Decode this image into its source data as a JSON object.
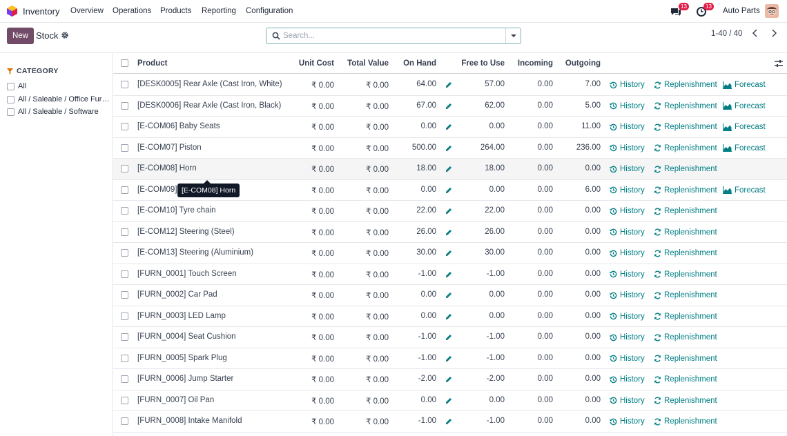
{
  "app": {
    "name": "Inventory",
    "logo_icon": "inventory-logo-icon"
  },
  "menu": [
    {
      "label": "Overview"
    },
    {
      "label": "Operations"
    },
    {
      "label": "Products"
    },
    {
      "label": "Reporting"
    },
    {
      "label": "Configuration"
    }
  ],
  "systray": {
    "messages_count": "13",
    "activities_count": "13",
    "company": "Auto Parts"
  },
  "control": {
    "new_label": "New",
    "title": "Stock",
    "search_placeholder": "Search...",
    "pager": "1-40 / 40"
  },
  "sidebar": {
    "title": "CATEGORY",
    "items": [
      {
        "label": "All"
      },
      {
        "label": "All / Saleable / Office Furn..."
      },
      {
        "label": "All / Saleable / Software"
      }
    ]
  },
  "table": {
    "headers": {
      "product": "Product",
      "unit_cost": "Unit Cost",
      "total_value": "Total Value",
      "on_hand": "On Hand",
      "free_to_use": "Free to Use",
      "incoming": "Incoming",
      "outgoing": "Outgoing"
    },
    "action_labels": {
      "history": "History",
      "replenishment": "Replenishment",
      "forecast": "Forecast"
    },
    "rows": [
      {
        "product": "[DESK0005] Rear Axle (Cast Iron, White)",
        "unit_cost": "₹ 0.00",
        "total_value": "₹ 0.00",
        "on_hand": "64.00",
        "free": "57.00",
        "incoming": "0.00",
        "outgoing": "7.00",
        "forecast": true
      },
      {
        "product": "[DESK0006] Rear Axle (Cast Iron, Black)",
        "unit_cost": "₹ 0.00",
        "total_value": "₹ 0.00",
        "on_hand": "67.00",
        "free": "62.00",
        "incoming": "0.00",
        "outgoing": "5.00",
        "forecast": true
      },
      {
        "product": "[E-COM06] Baby Seats",
        "unit_cost": "₹ 0.00",
        "total_value": "₹ 0.00",
        "on_hand": "0.00",
        "free": "0.00",
        "incoming": "0.00",
        "outgoing": "11.00",
        "forecast": true
      },
      {
        "product": "[E-COM07] Piston",
        "unit_cost": "₹ 0.00",
        "total_value": "₹ 0.00",
        "on_hand": "500.00",
        "free": "264.00",
        "incoming": "0.00",
        "outgoing": "236.00",
        "forecast": true
      },
      {
        "product": "[E-COM08] Horn",
        "unit_cost": "₹ 0.00",
        "total_value": "₹ 0.00",
        "on_hand": "18.00",
        "free": "18.00",
        "incoming": "0.00",
        "outgoing": "0.00",
        "forecast": false
      },
      {
        "product": "[E-COM09]",
        "unit_cost": "₹ 0.00",
        "total_value": "₹ 0.00",
        "on_hand": "0.00",
        "free": "0.00",
        "incoming": "0.00",
        "outgoing": "6.00",
        "forecast": true
      },
      {
        "product": "[E-COM10] Tyre chain",
        "unit_cost": "₹ 0.00",
        "total_value": "₹ 0.00",
        "on_hand": "22.00",
        "free": "22.00",
        "incoming": "0.00",
        "outgoing": "0.00",
        "forecast": false
      },
      {
        "product": "[E-COM12] Steering (Steel)",
        "unit_cost": "₹ 0.00",
        "total_value": "₹ 0.00",
        "on_hand": "26.00",
        "free": "26.00",
        "incoming": "0.00",
        "outgoing": "0.00",
        "forecast": false
      },
      {
        "product": "[E-COM13] Steering (Aluminium)",
        "unit_cost": "₹ 0.00",
        "total_value": "₹ 0.00",
        "on_hand": "30.00",
        "free": "30.00",
        "incoming": "0.00",
        "outgoing": "0.00",
        "forecast": false
      },
      {
        "product": "[FURN_0001] Touch Screen",
        "unit_cost": "₹ 0.00",
        "total_value": "₹ 0.00",
        "on_hand": "-1.00",
        "free": "-1.00",
        "incoming": "0.00",
        "outgoing": "0.00",
        "forecast": false
      },
      {
        "product": "[FURN_0002] Car Pad",
        "unit_cost": "₹ 0.00",
        "total_value": "₹ 0.00",
        "on_hand": "0.00",
        "free": "0.00",
        "incoming": "0.00",
        "outgoing": "0.00",
        "forecast": false
      },
      {
        "product": "[FURN_0003] LED Lamp",
        "unit_cost": "₹ 0.00",
        "total_value": "₹ 0.00",
        "on_hand": "0.00",
        "free": "0.00",
        "incoming": "0.00",
        "outgoing": "0.00",
        "forecast": false
      },
      {
        "product": "[FURN_0004] Seat Cushion",
        "unit_cost": "₹ 0.00",
        "total_value": "₹ 0.00",
        "on_hand": "-1.00",
        "free": "-1.00",
        "incoming": "0.00",
        "outgoing": "0.00",
        "forecast": false
      },
      {
        "product": "[FURN_0005] Spark Plug",
        "unit_cost": "₹ 0.00",
        "total_value": "₹ 0.00",
        "on_hand": "-1.00",
        "free": "-1.00",
        "incoming": "0.00",
        "outgoing": "0.00",
        "forecast": false
      },
      {
        "product": "[FURN_0006] Jump Starter",
        "unit_cost": "₹ 0.00",
        "total_value": "₹ 0.00",
        "on_hand": "-2.00",
        "free": "-2.00",
        "incoming": "0.00",
        "outgoing": "0.00",
        "forecast": false
      },
      {
        "product": "[FURN_0007] Oil Pan",
        "unit_cost": "₹ 0.00",
        "total_value": "₹ 0.00",
        "on_hand": "0.00",
        "free": "0.00",
        "incoming": "0.00",
        "outgoing": "0.00",
        "forecast": false
      },
      {
        "product": "[FURN_0008] Intake Manifold",
        "unit_cost": "₹ 0.00",
        "total_value": "₹ 0.00",
        "on_hand": "-1.00",
        "free": "-1.00",
        "incoming": "0.00",
        "outgoing": "0.00",
        "forecast": false
      }
    ]
  },
  "tooltip": {
    "text": "[E-COM08] Horn"
  },
  "colors": {
    "brand": "#714b67",
    "action": "#017e84",
    "badge": "#e11d48"
  }
}
